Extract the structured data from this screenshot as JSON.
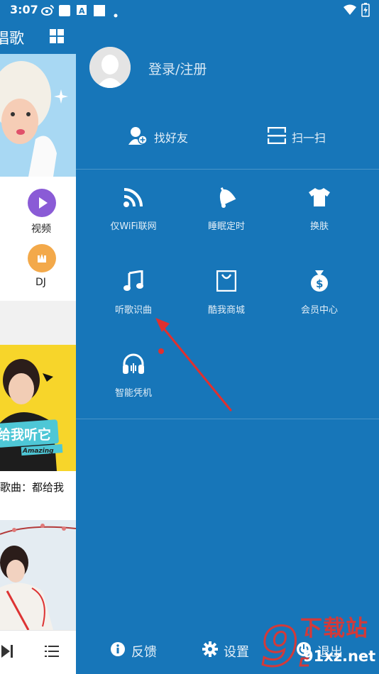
{
  "status_bar": {
    "time": "3:07"
  },
  "background_app": {
    "title": "唱歌",
    "quick_items": [
      {
        "label": "视频",
        "color": "#8a5bd6"
      },
      {
        "label": "DJ",
        "color": "#f3a94a"
      }
    ],
    "banner_text": "给我听它",
    "banner_tag": "Amazing",
    "song_title": "歌曲：都给我"
  },
  "drawer": {
    "login_label": "登录/注册",
    "find_friends_label": "找好友",
    "scan_label": "扫一扫",
    "grid": [
      {
        "label": "仅WiFi联网",
        "icon": "wifi-icon"
      },
      {
        "label": "睡眠定时",
        "icon": "bell-timer-icon"
      },
      {
        "label": "换肤",
        "icon": "shirt-icon"
      },
      {
        "label": "听歌识曲",
        "icon": "music-note-icon"
      },
      {
        "label": "酷我商城",
        "icon": "shopping-bag-icon"
      },
      {
        "label": "会员中心",
        "icon": "money-bag-icon"
      },
      {
        "label": "智能凭机",
        "icon": "headphones-icon"
      }
    ],
    "bottom": {
      "feedback_label": "反馈",
      "settings_label": "设置",
      "exit_label": "退出"
    }
  },
  "watermark": {
    "brand": "下载站",
    "domain": "91xz.net",
    "logo_number": "91"
  },
  "colors": {
    "drawer_bg": "#1776b9",
    "accent_red": "#e0302f"
  }
}
